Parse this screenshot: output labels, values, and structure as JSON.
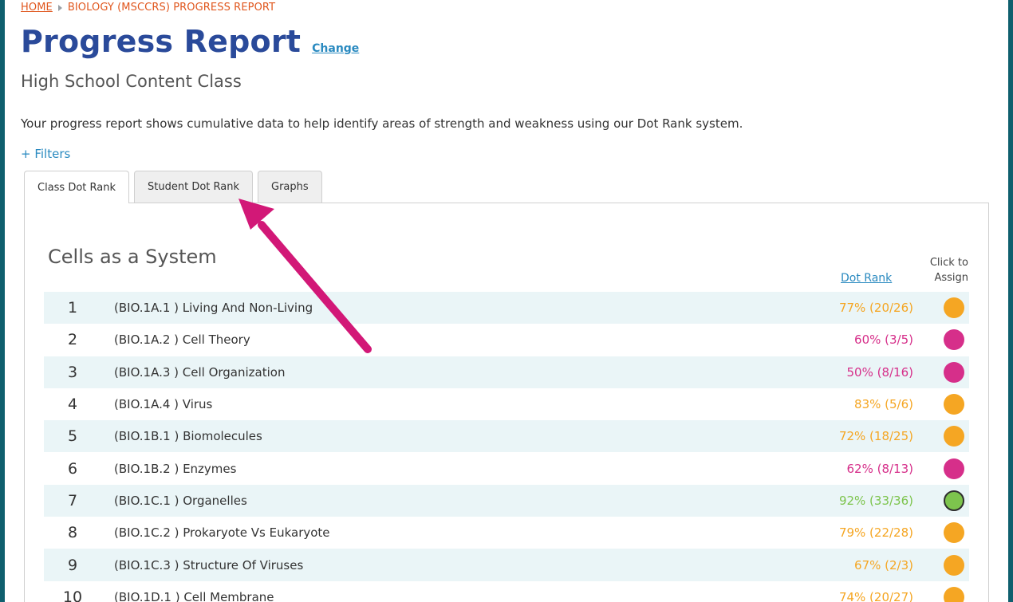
{
  "breadcrumb": {
    "home": "HOME",
    "current": "BIOLOGY (MSCCRS) PROGRESS REPORT"
  },
  "header": {
    "title": "Progress Report",
    "change_link": "Change",
    "subtitle": "High School Content Class"
  },
  "description": "Your progress report shows cumulative data to help identify areas of strength and weakness using our Dot Rank system.",
  "filters_label": "+ Filters",
  "tabs": [
    "Class Dot Rank",
    "Student Dot Rank",
    "Graphs"
  ],
  "active_tab": "Class Dot Rank",
  "section": {
    "title": "Cells as a System",
    "dot_rank_header": "Dot Rank",
    "assign_header_line1": "Click to",
    "assign_header_line2": "Assign"
  },
  "colors": {
    "orange": "#f5a623",
    "pink": "#d62f8a",
    "green": "#7dc44d"
  },
  "rows": [
    {
      "num": "1",
      "label": "(BIO.1A.1 ) Living And Non-Living",
      "rank": "77% (20/26)",
      "color": "orange"
    },
    {
      "num": "2",
      "label": "(BIO.1A.2 ) Cell Theory",
      "rank": "60% (3/5)",
      "color": "pink"
    },
    {
      "num": "3",
      "label": "(BIO.1A.3 ) Cell Organization",
      "rank": "50% (8/16)",
      "color": "pink"
    },
    {
      "num": "4",
      "label": "(BIO.1A.4 ) Virus",
      "rank": "83% (5/6)",
      "color": "orange"
    },
    {
      "num": "5",
      "label": "(BIO.1B.1 ) Biomolecules",
      "rank": "72% (18/25)",
      "color": "orange"
    },
    {
      "num": "6",
      "label": "(BIO.1B.2 ) Enzymes",
      "rank": "62% (8/13)",
      "color": "pink"
    },
    {
      "num": "7",
      "label": "(BIO.1C.1 ) Organelles",
      "rank": "92% (33/36)",
      "color": "green"
    },
    {
      "num": "8",
      "label": "(BIO.1C.2 ) Prokaryote Vs Eukaryote",
      "rank": "79% (22/28)",
      "color": "orange"
    },
    {
      "num": "9",
      "label": "(BIO.1C.3 ) Structure Of Viruses",
      "rank": "67% (2/3)",
      "color": "orange"
    },
    {
      "num": "10",
      "label": "(BIO.1D.1 ) Cell Membrane",
      "rank": "74% (20/27)",
      "color": "orange"
    }
  ]
}
